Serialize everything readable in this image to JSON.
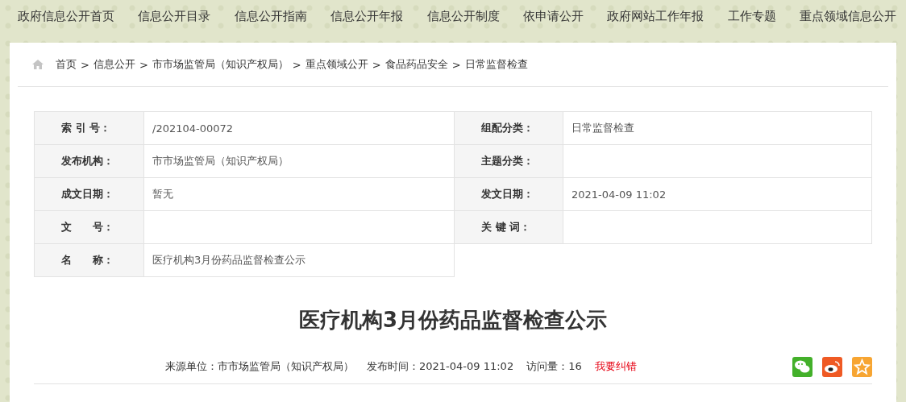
{
  "nav": [
    "政府信息公开首页",
    "信息公开目录",
    "信息公开指南",
    "信息公开年报",
    "信息公开制度",
    "依申请公开",
    "政府网站工作年报",
    "工作专题",
    "重点领域信息公开"
  ],
  "breadcrumb": {
    "separator": ">",
    "items": [
      "首页",
      "信息公开",
      "市市场监管局（知识产权局）",
      "重点领域公开",
      "食品药品安全",
      "日常监督检查"
    ]
  },
  "info_table": [
    {
      "cells": [
        {
          "label": "索 引 号：",
          "value": "/202104-00072"
        },
        {
          "label": "组配分类：",
          "value": "日常监督检查"
        }
      ]
    },
    {
      "cells": [
        {
          "label": "发布机构：",
          "value": "市市场监管局（知识产权局）"
        },
        {
          "label": "主题分类："
        }
      ]
    },
    {
      "cells": [
        {
          "label": "成文日期：",
          "value": "暂无"
        },
        {
          "label": "发文日期：",
          "value": "2021-04-09 11:02"
        }
      ]
    },
    {
      "cells": [
        {
          "label": "文　　号："
        },
        {
          "label": "关 键 词："
        }
      ]
    },
    {
      "cells": [
        {
          "label": "名　　称：",
          "value": "医疗机构3月份药品监督检查公示"
        }
      ]
    }
  ],
  "article": {
    "title": "医疗机构3月份药品监督检查公示",
    "meta": [
      {
        "kind": "text",
        "text": "来源单位：市市场监管局（知识产权局）"
      },
      {
        "kind": "text",
        "text": "发布时间：2021-04-09 11:02"
      },
      {
        "kind": "text",
        "text": "访问量：16"
      },
      {
        "kind": "link",
        "text": "我要纠错"
      }
    ],
    "share": [
      {
        "kind": "wechat"
      },
      {
        "kind": "weibo"
      },
      {
        "kind": "favorite"
      }
    ]
  }
}
